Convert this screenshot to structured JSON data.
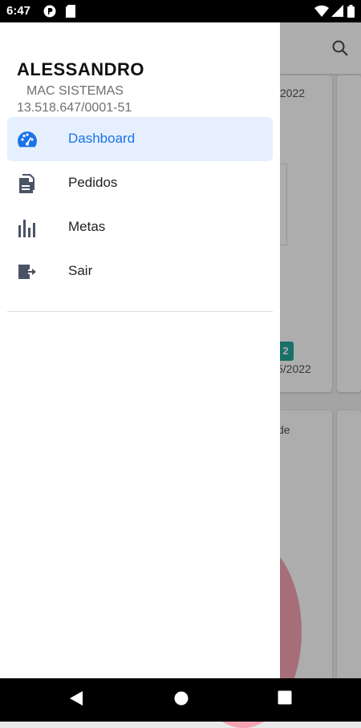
{
  "status_bar": {
    "time": "6:47",
    "icons": [
      "notification-p-icon",
      "sd-card-icon",
      "wifi-icon",
      "signal-icon",
      "battery-icon"
    ]
  },
  "background": {
    "date_1": "/2022",
    "badge": "2",
    "date_2": "5/2022",
    "card_label": "de",
    "accent_badge": "#26a69a",
    "pie_color": "#f5a3b3"
  },
  "drawer": {
    "user_name": "ALESSANDRO",
    "company": "MAC SISTEMAS",
    "cnpj": "13.518.647/0001-51",
    "items": [
      {
        "label": "Dashboard",
        "icon": "speedometer-icon",
        "active": true
      },
      {
        "label": "Pedidos",
        "icon": "documents-icon",
        "active": false
      },
      {
        "label": "Metas",
        "icon": "bar-chart-icon",
        "active": false
      },
      {
        "label": "Sair",
        "icon": "logout-icon",
        "active": false
      }
    ],
    "accent_color": "#1a73e8",
    "active_bg": "#e6effd",
    "icon_color": "#4a5366"
  }
}
